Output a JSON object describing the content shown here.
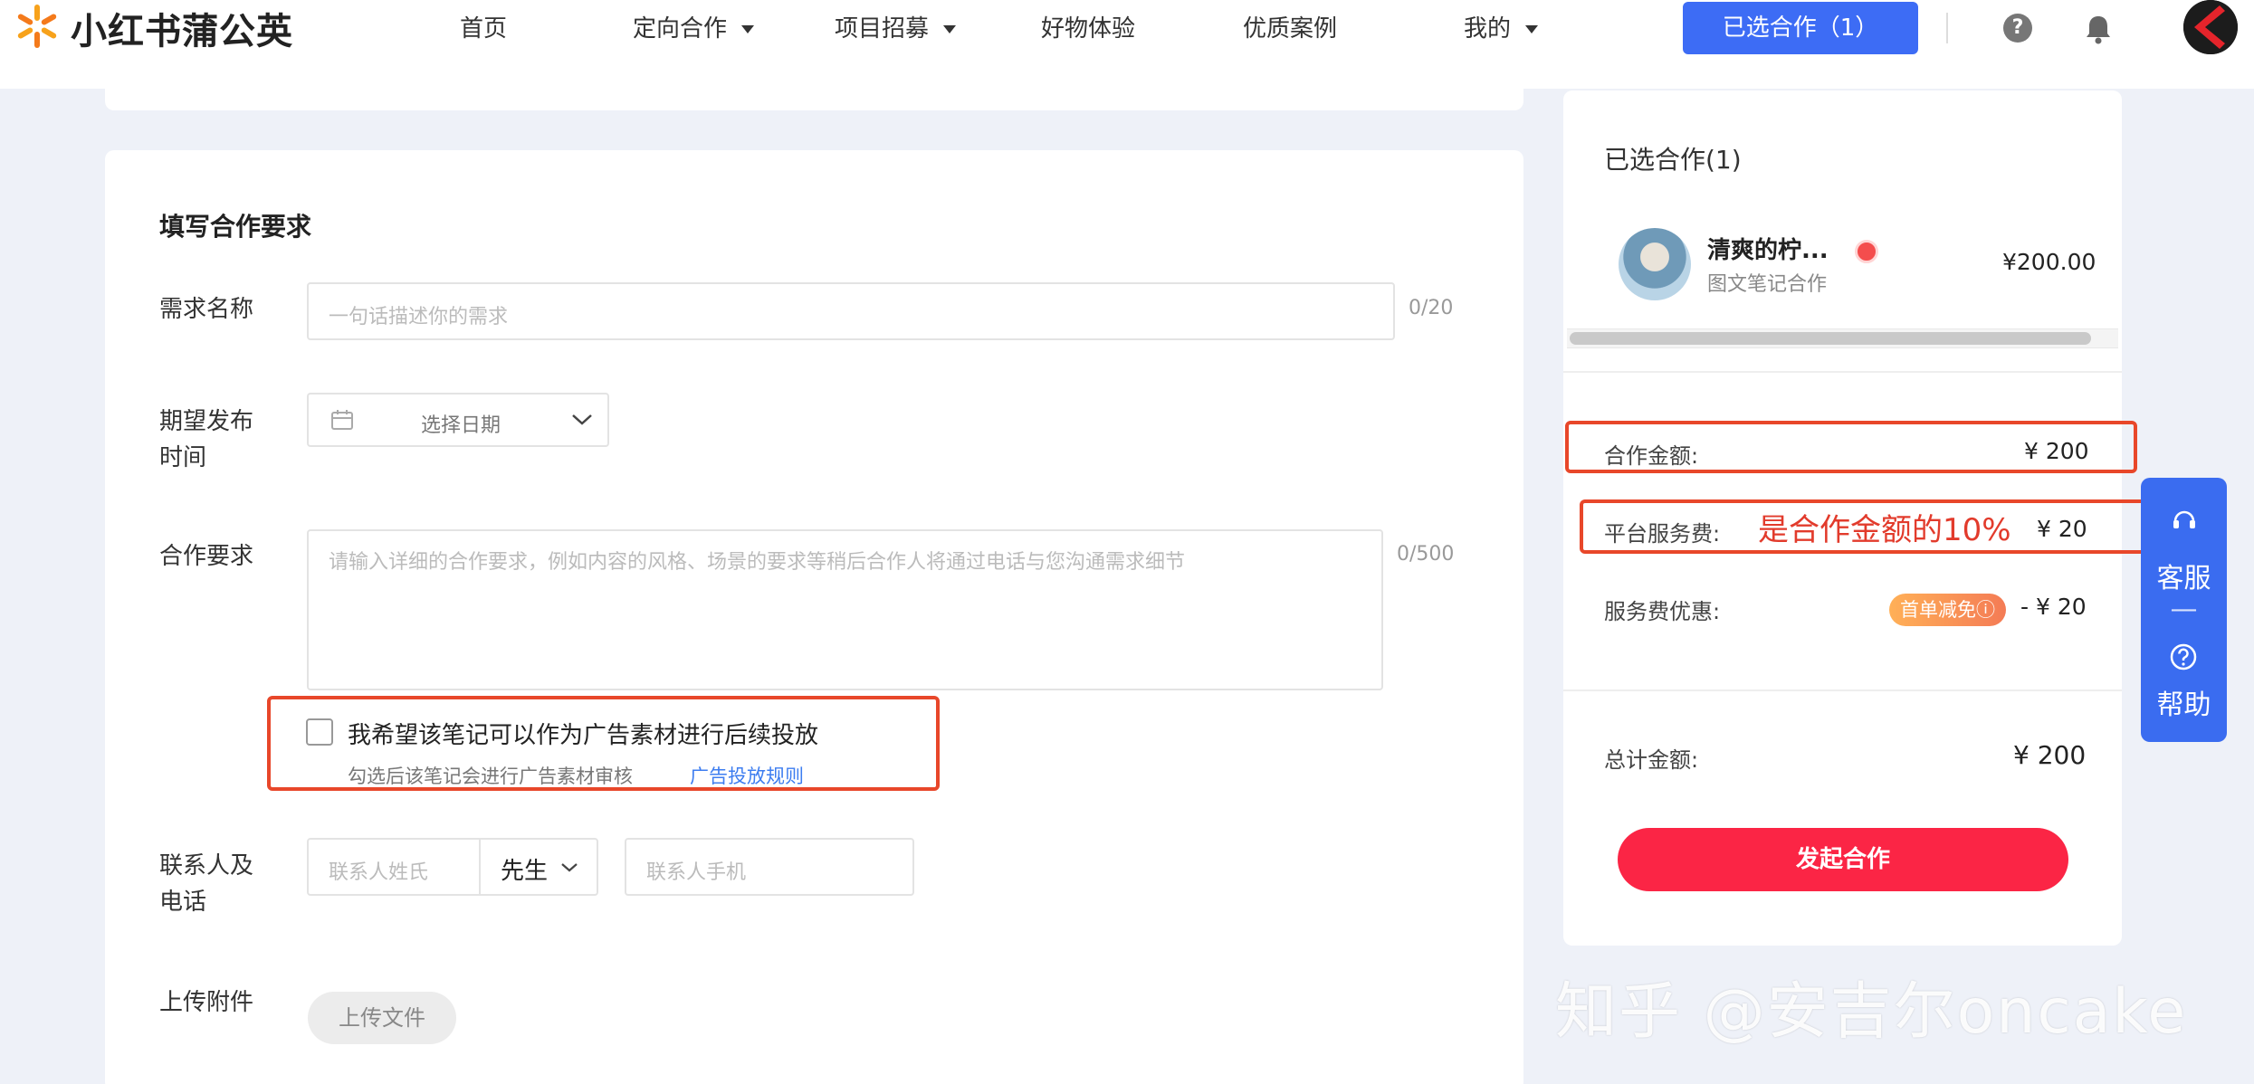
{
  "app": {
    "logo_text": "小红书蒲公英"
  },
  "nav": [
    {
      "label": "首页"
    },
    {
      "label": "定向合作"
    },
    {
      "label": "项目招募"
    },
    {
      "label": "好物体验"
    },
    {
      "label": "优质案例"
    },
    {
      "label": "我的"
    }
  ],
  "header": {
    "selected_button": "已选合作（1）",
    "help_glyph": "?"
  },
  "form": {
    "title": "填写合作要求",
    "name_label": "需求名称",
    "name_placeholder": "一句话描述你的需求",
    "name_count": "0/20",
    "date_label_1": "期望发布",
    "date_label_2": "时间",
    "date_placeholder": "选择日期",
    "req_label": "合作要求",
    "req_placeholder": "请输入详细的合作要求，例如内容的风格、场景的要求等稍后合作人将通过电话与您沟通需求细节",
    "req_count": "0/500",
    "ad_checkbox_label": "我希望该笔记可以作为广告素材进行后续投放",
    "ad_hint": "勾选后该笔记会进行广告素材审核",
    "ad_rule_link": "广告投放规则",
    "contact_label_1": "联系人及",
    "contact_label_2": "电话",
    "contact_name_placeholder": "联系人姓氏",
    "contact_title_value": "先生",
    "contact_phone_placeholder": "联系人手机",
    "upload_label": "上传附件",
    "upload_button": "上传文件"
  },
  "summary": {
    "title": "已选合作(1)",
    "item_name": "清爽的柠...",
    "item_type": "图文笔记合作",
    "item_price": "¥200.00",
    "amount_label": "合作金额:",
    "amount_value": "¥ 200",
    "fee_label": "平台服务费:",
    "fee_annotation": "是合作金额的10%",
    "fee_value": "¥ 20",
    "discount_label": "服务费优惠:",
    "discount_badge": "首单减免ⓘ",
    "discount_value": "- ¥ 20",
    "total_label": "总计金额:",
    "total_value": "¥ 200",
    "start_button": "发起合作"
  },
  "float_panel": {
    "service_label": "客服",
    "help_label": "帮助",
    "separator": "—"
  },
  "watermark": "知乎 @安吉尔oncake",
  "colors": {
    "primary_blue": "#3d6cf5",
    "cta_red": "#fb2545",
    "highlight_red": "#e8472a",
    "promo_orange": "#f47b55"
  },
  "icons": [
    "pinwheel-logo-icon",
    "caret-down-icon",
    "help-circle-icon",
    "bell-icon",
    "calendar-icon",
    "chevron-down-icon",
    "verified-badge-icon",
    "headset-icon",
    "question-icon"
  ]
}
